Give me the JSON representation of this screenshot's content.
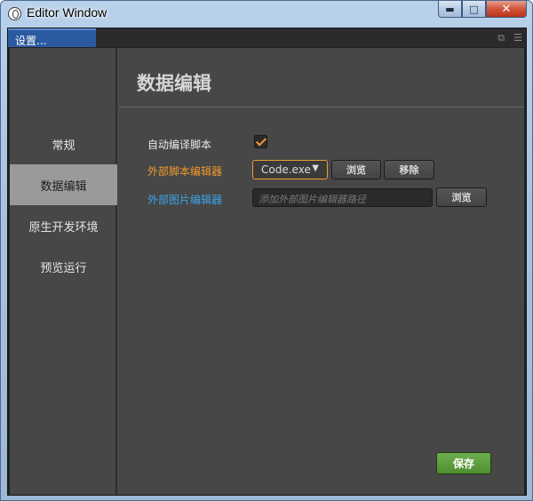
{
  "window": {
    "title": "Editor Window",
    "controls": {
      "minimize": "▬",
      "maximize": "□",
      "close": "✕"
    }
  },
  "tab": {
    "label": "设置..."
  },
  "sidebar": {
    "items": [
      {
        "label": "常规",
        "active": false
      },
      {
        "label": "数据编辑",
        "active": true
      },
      {
        "label": "原生开发环境",
        "active": false
      },
      {
        "label": "预览运行",
        "active": false
      }
    ]
  },
  "main": {
    "heading": "数据编辑",
    "auto_compile": {
      "label": "自动编译脚本",
      "checked": true
    },
    "script_editor": {
      "label": "外部脚本编辑器",
      "selected": "Code.exe",
      "browse_label": "浏览",
      "remove_label": "移除"
    },
    "image_editor": {
      "label": "外部图片编辑器",
      "placeholder": "添加外部图片编辑器路径",
      "browse_label": "浏览"
    },
    "save_label": "保存"
  },
  "colors": {
    "accent_orange": "#f39a2e",
    "accent_blue": "#3aa6ec",
    "save_green": "#5a9e3a",
    "tab_blue": "#2c5aa0"
  },
  "icons": {
    "app": "app-logo-icon",
    "window_restore": "restore-icon",
    "window_menu": "menu-icon"
  }
}
